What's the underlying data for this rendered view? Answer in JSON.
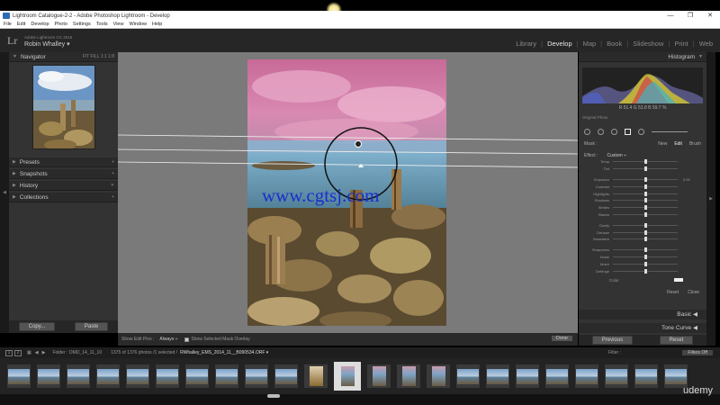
{
  "window": {
    "title": "Lightroom Catalogue-2-2 - Adobe Photoshop Lightroom - Develop",
    "controls": [
      "—",
      "❐",
      "✕"
    ]
  },
  "menu": [
    "File",
    "Edit",
    "Develop",
    "Photo",
    "Settings",
    "Tools",
    "View",
    "Window",
    "Help"
  ],
  "identity": {
    "logo": "Lr",
    "product": "Adobe Lightroom CC 2015",
    "user": "Robin Whalley ▾"
  },
  "modules": [
    "Library",
    "Develop",
    "Map",
    "Book",
    "Slideshow",
    "Print",
    "Web"
  ],
  "active_module": "Develop",
  "left_panel": {
    "navigator": {
      "label": "Navigator",
      "zoom": "FIT  FILL  1:1  1:8"
    },
    "sections": [
      {
        "label": "Presets",
        "right": "+"
      },
      {
        "label": "Snapshots",
        "right": "+"
      },
      {
        "label": "History",
        "right": "✕"
      },
      {
        "label": "Collections",
        "right": "+"
      }
    ],
    "copy_label": "Copy...",
    "paste_label": "Paste"
  },
  "toolstrip": {
    "show_edit_pins": "Show Edit Pins :",
    "always": "Always ÷",
    "show_mask": "Show Selected Mask Overlay",
    "done": "Done"
  },
  "watermark": "www.cgtsj.com",
  "right_panel": {
    "histogram_label": "Histogram",
    "rgb_readout": "R  51.4   G  53.8   B  59.7  %",
    "original_photo": "Original Photo",
    "mask": {
      "label": "Mask :",
      "new": "New",
      "edit": "Edit",
      "brush": "Brush"
    },
    "effect": {
      "label": "Effect :",
      "value": "Custom ÷"
    },
    "sliders_group1": [
      "Temp",
      "Tint"
    ],
    "sliders_group2": [
      "Exposure",
      "Contrast",
      "Highlights",
      "Shadows",
      "Whites",
      "Blacks"
    ],
    "exposure_value": "0.00",
    "sliders_group3": [
      "Clarity",
      "Dehaze",
      "Saturation"
    ],
    "sliders_group4": [
      "Sharpness",
      "Noise",
      "Moiré",
      "Defringe"
    ],
    "color_label": "Color",
    "reset": "Reset",
    "close": "Close",
    "basic": "Basic",
    "tone_curve": "Tone Curve",
    "previous_label": "Previous",
    "reset_label": "Reset"
  },
  "filmstrip_status": {
    "pages": [
      "1",
      "2"
    ],
    "folder": "Folder : OMD_14_11_10",
    "count": "1375 of 1376 photos /1 selected /",
    "file": "RWhalley_EMS_2014_11__B090534.ORF ▾",
    "filter": "Filter :",
    "filter_value": "Filters Off"
  },
  "brand": "udemy",
  "colors": {
    "panel": "#333333",
    "canvas": "#7a7a7a",
    "accent_lr": "#2d6bb5",
    "watermark": "#1a2fcc"
  }
}
